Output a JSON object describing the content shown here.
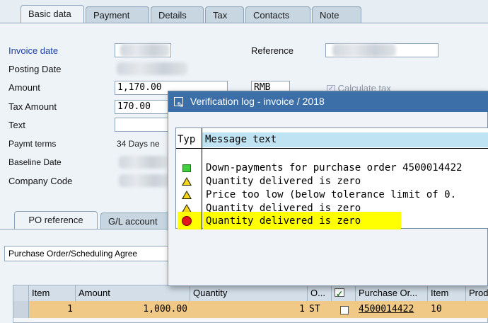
{
  "top_tabs": [
    "Basic data",
    "Payment",
    "Details",
    "Tax",
    "Contacts",
    "Note"
  ],
  "basic_data": {
    "invoice_date_label": "Invoice date",
    "posting_date_label": "Posting Date",
    "amount_label": "Amount",
    "amount_value": "1,170.00",
    "currency_value": "RMB",
    "tax_amount_label": "Tax Amount",
    "tax_amount_value": "170.00",
    "text_label": "Text",
    "paymt_terms_label": "Paymt terms",
    "paymt_terms_value": "34 Days ne",
    "baseline_date_label": "Baseline Date",
    "company_code_label": "Company Code",
    "reference_label": "Reference",
    "calculate_tax_label": "Calculate tax"
  },
  "bottom_tabs": [
    "PO reference",
    "G/L account"
  ],
  "po_reference": {
    "dropdown_value": "Purchase Order/Scheduling Agree"
  },
  "items_grid": {
    "headers": [
      "Item",
      "Amount",
      "Quantity",
      "O...",
      "",
      "Purchase Or...",
      "Item",
      "Prod"
    ],
    "row": {
      "item": "1",
      "amount": "1,000.00",
      "quantity": "1",
      "uom": "ST",
      "po": "4500014422",
      "po_item": "10"
    }
  },
  "dialog": {
    "title": "Verification log - invoice  / 2018",
    "col_type": "Typ",
    "col_message": "Message text",
    "messages": [
      {
        "type": "green-square",
        "text": "Down-payments for purchase order 4500014422"
      },
      {
        "type": "warning",
        "text": "Quantity delivered is zero"
      },
      {
        "type": "warning",
        "text": "Price too low (below tolerance limit of 0."
      },
      {
        "type": "warning",
        "text": "Quantity delivered is zero"
      },
      {
        "type": "error",
        "text": "Quantity delivered is zero"
      }
    ],
    "highlight_color": "#ffff00"
  }
}
